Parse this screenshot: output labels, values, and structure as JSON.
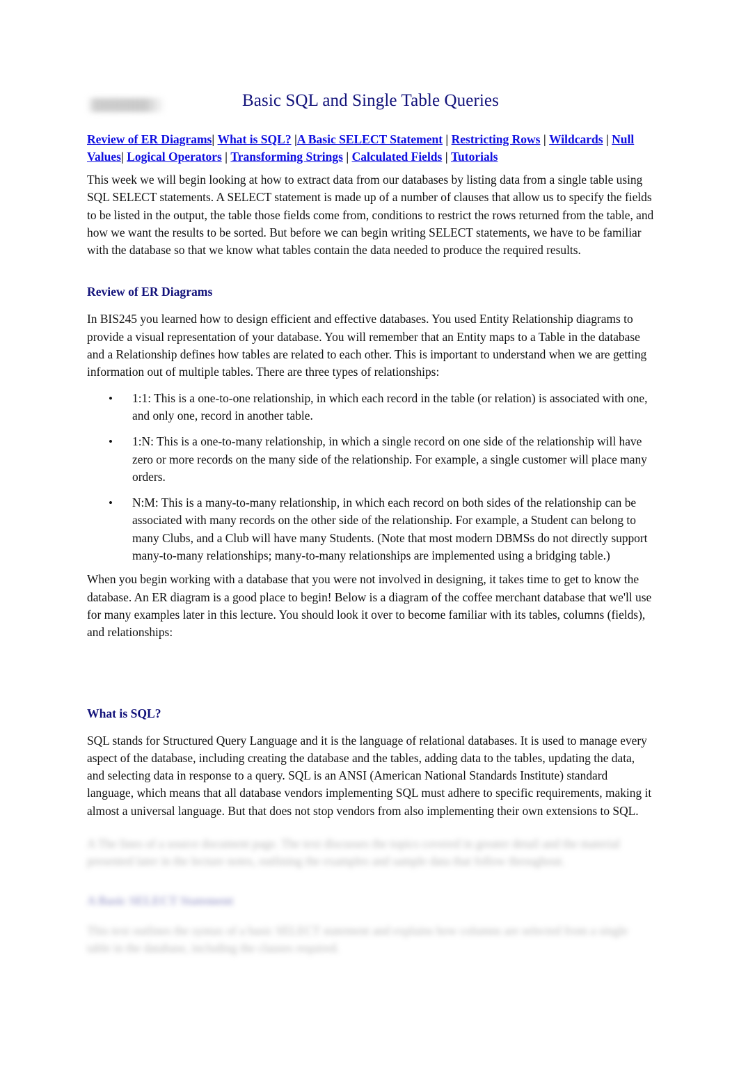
{
  "document": {
    "title": "Basic SQL and Single Table Queries",
    "redacted_title_prefix": "redacted-bar"
  },
  "nav": {
    "separator": "|",
    "links": [
      "Review of ER Diagrams",
      "What is SQL?",
      "A Basic SELECT Statement",
      "Restricting Rows",
      "Wildcards",
      "Null Values",
      "Logical Operators",
      "Transforming Strings",
      "Calculated Fields",
      "Tutorials"
    ]
  },
  "intro": {
    "paragraph": "This week we will begin looking at how to extract data from our databases by listing data from a single table using SQL SELECT statements. A SELECT statement is made up of a number of clauses that allow us to specify the fields to be listed in the output, the table those fields come from, conditions to restrict the rows returned from the table, and how we want the results to be sorted. But before we can begin writing SELECT statements, we have to be familiar with the database so that we know what tables contain the data needed to produce the required results."
  },
  "section_er": {
    "heading": "Review of ER Diagrams",
    "paragraph": "In BIS245 you learned how to design efficient and effective databases. You used Entity Relationship diagrams to provide a visual representation of your database. You will remember that an Entity maps to a Table in the database and a Relationship defines how tables are related to each other. This is important to understand when we are getting information out of multiple tables. There are three types of relationships:",
    "bullet_marker": "•",
    "bullets": [
      "1:1: This is a one-to-one relationship, in which each record in the table (or relation) is associated with one, and only one, record in another table.",
      "1:N: This is a one-to-many relationship, in which a single record on one side of the relationship will have zero or more records on the many side of the relationship. For example, a single customer will place many orders.",
      "N:M: This is a many-to-many relationship, in which each record on both sides of the relationship can be associated with many records on the other side of the relationship. For example, a Student can belong to many Clubs, and a Club will have many Students. (Note that most modern DBMSs do not directly support many-to-many relationships; many-to-many relationships are implemented using a bridging table.)"
    ],
    "closing_paragraph": "When you begin working with a database that you were not involved in designing, it takes time to get to know the database. An ER diagram is a good place to begin! Below is a diagram of the coffee merchant database that we'll use for many examples later in this lecture. You should look it over to become familiar with its tables, columns (fields), and relationships:"
  },
  "section_sql": {
    "heading": "What is SQL?",
    "paragraph": "SQL stands for Structured Query Language and it is the language of relational databases. It is used to manage every aspect of the database, including creating the database and the tables, adding data to the tables, updating the data, and selecting data in response to a query. SQL is an ANSI (American National Standards Institute) standard language, which means that all database vendors implementing SQL must adhere to specific requirements, making it almost a universal language. But that does not stop vendors from also implementing their own extensions to SQL."
  },
  "obscured": {
    "paragraph_one": "A The lines of a source document page. The text discusses the topics covered in greater detail and the material presented later in the lecture notes, outlining the examples and sample data that follow throughout.",
    "heading": "A Basic SELECT Statement",
    "paragraph_two": "This text outlines the syntax of a basic SELECT statement and explains how columns are selected from a single table in the database, including the clauses required."
  },
  "colors": {
    "title": "#12127a",
    "heading": "#12127a",
    "link": "#0f0fe0",
    "body_text": "#111111",
    "background": "#ffffff"
  }
}
